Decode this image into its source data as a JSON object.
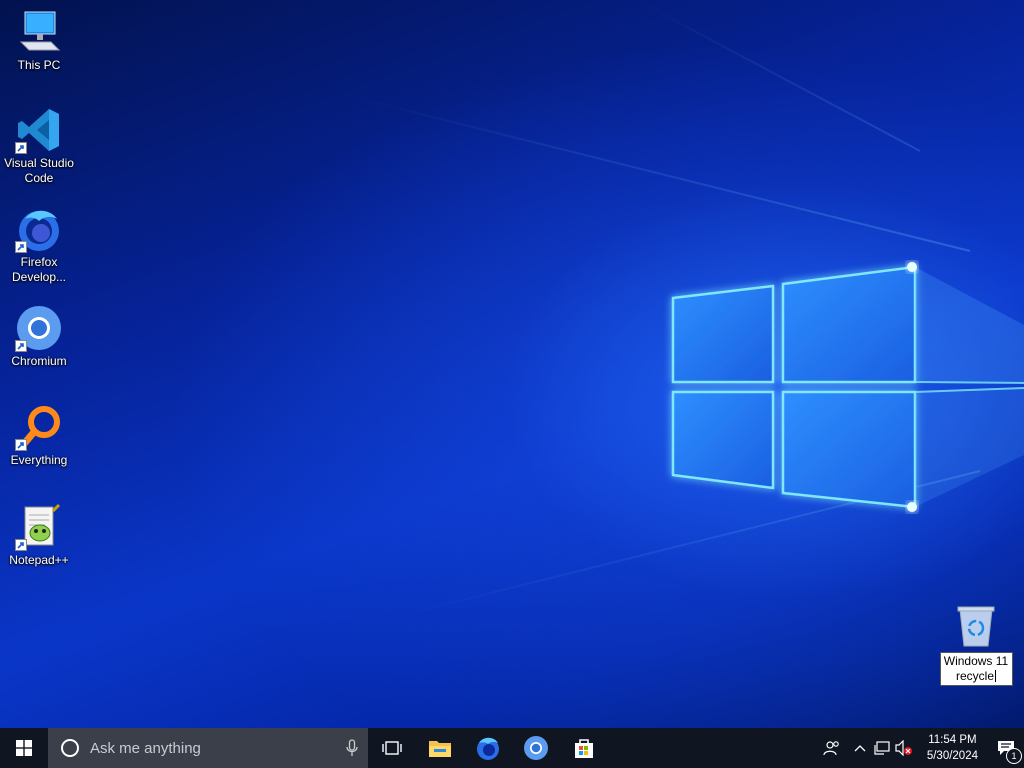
{
  "desktop": {
    "icons": [
      {
        "label": "This PC",
        "icon": "computer-icon"
      },
      {
        "label": "Visual Studio Code",
        "icon": "vscode-icon"
      },
      {
        "label": "Firefox Develop...",
        "icon": "firefox-developer-icon"
      },
      {
        "label": "Chromium",
        "icon": "chromium-icon"
      },
      {
        "label": "Everything",
        "icon": "everything-search-icon"
      },
      {
        "label": "Notepad++",
        "icon": "notepad-plus-plus-icon"
      }
    ],
    "recycle_bin": {
      "icon": "recycle-bin-icon",
      "rename_value": "Windows 11 recycle"
    }
  },
  "taskbar": {
    "search_placeholder": "Ask me anything",
    "pinned": [
      "task-view-icon",
      "file-explorer-icon",
      "firefox-developer-icon",
      "chromium-icon",
      "microsoft-store-icon"
    ],
    "clock": {
      "time": "11:54 PM",
      "date": "5/30/2024"
    },
    "notifications_count": "1"
  },
  "colors": {
    "taskbar": "#101522",
    "searchbox": "#3a3f4a",
    "accent": "#2ea8ff"
  }
}
